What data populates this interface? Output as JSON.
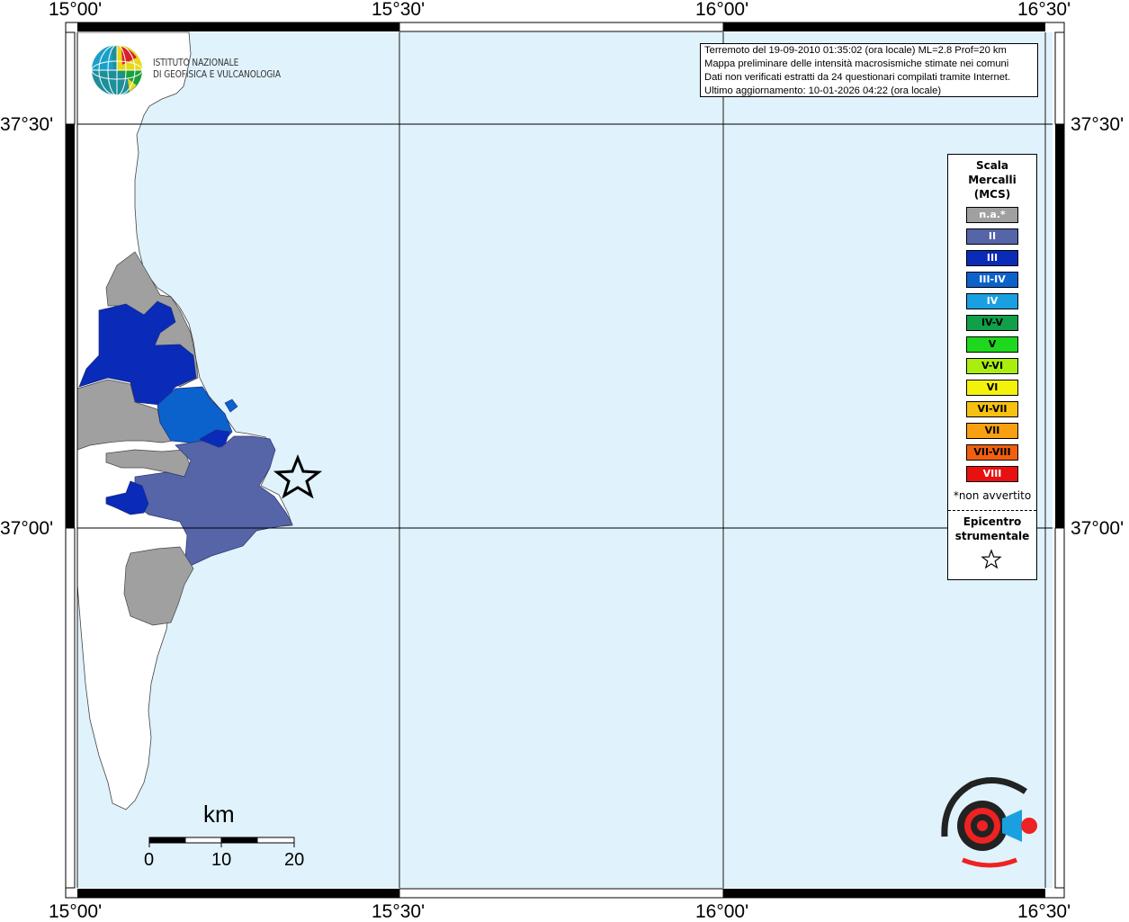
{
  "coords": {
    "lon": [
      "15°00'",
      "15°30'",
      "16°00'",
      "16°30'"
    ],
    "lat": [
      "37°30'",
      "37°00'"
    ]
  },
  "info": {
    "lines": [
      "Terremoto del 19-09-2010 01:35:02 (ora locale) ML=2.8 Prof=20 km",
      "Mappa preliminare delle intensità macrosismiche stimate nei comuni",
      "Dati non verificati estratti da 24 questionari compilati tramite Internet.",
      "Ultimo aggiornamento: 10-01-2026 04:22 (ora locale)"
    ]
  },
  "ingv": {
    "line1": "ISTITUTO NAZIONALE",
    "line2": "DI GEOFISICA E VULCANOLOGIA"
  },
  "legend": {
    "title1": "Scala",
    "title2": "Mercalli",
    "title3": "(MCS)",
    "classes": [
      {
        "label": "n.a.*",
        "color": "#a0a0a0",
        "text": "#ffffff"
      },
      {
        "label": "II",
        "color": "#5565a8",
        "text": "#ffffff"
      },
      {
        "label": "III",
        "color": "#0a2bb8",
        "text": "#ffffff"
      },
      {
        "label": "III-IV",
        "color": "#0b62cc",
        "text": "#ffffff"
      },
      {
        "label": "IV",
        "color": "#1aa0e0",
        "text": "#ffffff"
      },
      {
        "label": "IV-V",
        "color": "#10a04a",
        "text": "#000000"
      },
      {
        "label": "V",
        "color": "#1ed81e",
        "text": "#000000"
      },
      {
        "label": "V-VI",
        "color": "#aaee10",
        "text": "#000000"
      },
      {
        "label": "VI",
        "color": "#f4f20a",
        "text": "#000000"
      },
      {
        "label": "VI-VII",
        "color": "#f8c010",
        "text": "#000000"
      },
      {
        "label": "VII",
        "color": "#f8a010",
        "text": "#000000"
      },
      {
        "label": "VII-VIII",
        "color": "#f06010",
        "text": "#000000"
      },
      {
        "label": "VIII",
        "color": "#e81010",
        "text": "#ffffff"
      }
    ],
    "note": "*non avvertito",
    "epicenter1": "Epicentro",
    "epicenter2": "strumentale"
  },
  "scale": {
    "unit": "km",
    "ticks": [
      "0",
      "10",
      "20"
    ]
  },
  "colors": {
    "sea": "#e0f2fc",
    "land": "#ffffff",
    "na": "#a0a0a0",
    "ii": "#5565a8",
    "iii": "#0a2bb8",
    "iiiiv": "#0b62cc"
  },
  "icons": {
    "epicenter": "star-icon",
    "ingv_logo": "globe-icon",
    "hsit_logo": "target-icon"
  }
}
